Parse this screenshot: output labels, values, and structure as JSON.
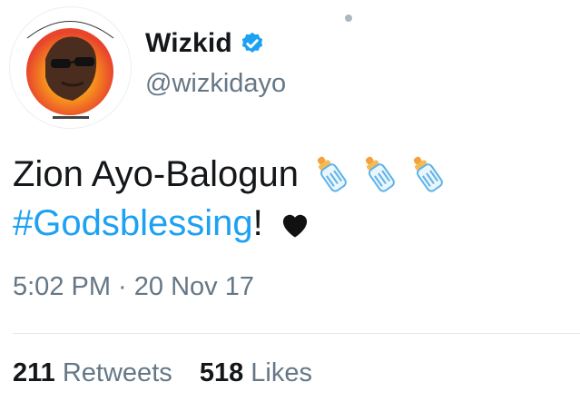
{
  "user": {
    "display_name": "Wizkid",
    "handle": "@wizkidayo",
    "avatar_icon": "avatar-image",
    "verified_icon": "verified-badge-icon"
  },
  "tweet": {
    "text_part1": "Zion Ayo-Balogun",
    "hashtag": "#Godsblessing",
    "text_part2": "!",
    "emoji": [
      "baby-bottle-icon",
      "baby-bottle-icon",
      "baby-bottle-icon",
      "black-heart-icon"
    ],
    "timestamp": "5:02 PM · 20 Nov 17"
  },
  "stats": {
    "retweets_count": "211",
    "retweets_label": "Retweets",
    "likes_count": "518",
    "likes_label": "Likes"
  },
  "colors": {
    "link": "#1da1f2",
    "secondary_text": "#657786",
    "primary_text": "#14171a",
    "divider": "#e1e8ed"
  }
}
